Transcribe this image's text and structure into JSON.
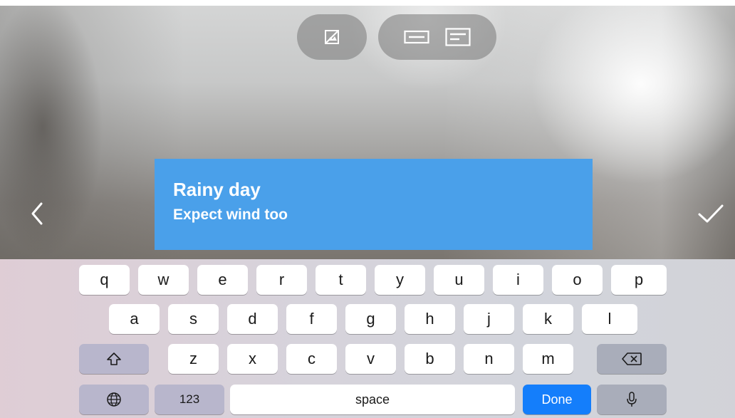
{
  "toolbar": {
    "group_1": [
      {
        "icon": "no-image-icon"
      }
    ],
    "group_2": [
      {
        "icon": "single-line-layout-icon"
      },
      {
        "icon": "multi-line-layout-icon"
      }
    ]
  },
  "nav": {
    "back_icon": "chevron-left-icon",
    "done_icon": "checkmark-icon"
  },
  "card": {
    "title": "Rainy day",
    "subtitle": "Expect wind too",
    "background": "#4aa0ea"
  },
  "keyboard": {
    "row1": [
      "q",
      "w",
      "e",
      "r",
      "t",
      "y",
      "u",
      "i",
      "o",
      "p"
    ],
    "row2": [
      "a",
      "s",
      "d",
      "f",
      "g",
      "h",
      "j",
      "k",
      "l"
    ],
    "row3": [
      "z",
      "x",
      "c",
      "v",
      "b",
      "n",
      "m"
    ],
    "shift_icon": "shift-icon",
    "delete_icon": "delete-backspace-icon",
    "globe_icon": "globe-icon",
    "numbers_label": "123",
    "space_label": "space",
    "done_label": "Done",
    "mic_icon": "microphone-icon",
    "done_color": "#147efb"
  }
}
